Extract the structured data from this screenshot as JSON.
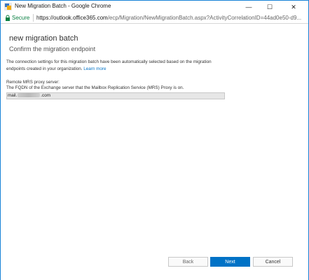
{
  "window": {
    "title": "New Migration Batch - Google Chrome",
    "controls": {
      "minimize": "—",
      "maximize": "☐",
      "close": "✕"
    }
  },
  "address_bar": {
    "secure_label": "Secure",
    "url_host": "https://outlook.office365.com",
    "url_path": "/ecp/Migration/NewMigrationBatch.aspx?ActivityCorrelationID=44ad0e50-d9..."
  },
  "page": {
    "title": "new migration batch",
    "subtitle": "Confirm the migration endpoint",
    "description": "The connection settings for this migration batch have been automatically selected based on the migration endpoints created in your organization.",
    "learn_more": "Learn more",
    "proxy_label": "Remote MRS proxy server:",
    "proxy_help": "The FQDN of the Exchange server that the Mailbox Replication Service (MRS) Proxy is on.",
    "proxy_value_prefix": "mail.",
    "proxy_value_suffix": ".com"
  },
  "buttons": {
    "back": "Back",
    "next": "Next",
    "cancel": "Cancel"
  },
  "colors": {
    "accent": "#0072c6",
    "secure": "#0b8043",
    "window_border": "#1883d7"
  }
}
